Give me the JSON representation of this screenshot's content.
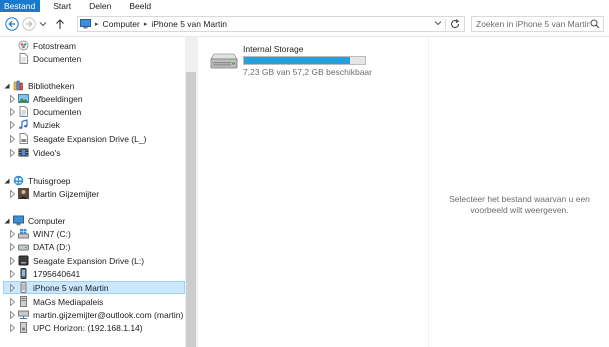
{
  "ribbon": {
    "tabs": [
      {
        "label": "Bestand",
        "active": true
      },
      {
        "label": "Start",
        "active": false
      },
      {
        "label": "Delen",
        "active": false
      },
      {
        "label": "Beeld",
        "active": false
      }
    ],
    "accent_color": "#1979ca"
  },
  "address_bar": {
    "crumbs": [
      "Computer",
      "iPhone 5 van Martin"
    ]
  },
  "search": {
    "placeholder": "Zoeken in iPhone 5 van Martin"
  },
  "nav_pane": {
    "items": [
      {
        "label": "Fotostream",
        "icon": "photostream-icon",
        "level": 1,
        "expander": "none"
      },
      {
        "label": "Documenten",
        "icon": "document-icon",
        "level": 1,
        "expander": "none"
      },
      {
        "label": "Bibliotheken",
        "icon": "libraries-icon",
        "level": 0,
        "expander": "expanded"
      },
      {
        "label": "Afbeeldingen",
        "icon": "pictures-icon",
        "level": 1,
        "expander": "collapsed"
      },
      {
        "label": "Documenten",
        "icon": "documents-library-icon",
        "level": 1,
        "expander": "collapsed"
      },
      {
        "label": "Muziek",
        "icon": "music-icon",
        "level": 1,
        "expander": "collapsed"
      },
      {
        "label": "Seagate Expansion Drive (L_)",
        "icon": "drive-library-icon",
        "level": 1,
        "expander": "collapsed"
      },
      {
        "label": "Video's",
        "icon": "videos-icon",
        "level": 1,
        "expander": "collapsed"
      },
      {
        "label": "Thuisgroep",
        "icon": "homegroup-icon",
        "level": 0,
        "expander": "expanded"
      },
      {
        "label": "Martin Gijzemijter",
        "icon": "user-photo-icon",
        "level": 1,
        "expander": "collapsed"
      },
      {
        "label": "Computer",
        "icon": "computer-icon",
        "level": 0,
        "expander": "expanded"
      },
      {
        "label": "WIN7 (C:)",
        "icon": "windows-drive-icon",
        "level": 1,
        "expander": "collapsed"
      },
      {
        "label": "DATA (D:)",
        "icon": "hard-drive-icon",
        "level": 1,
        "expander": "collapsed"
      },
      {
        "label": "Seagate Expansion Drive (L:)",
        "icon": "external-drive-icon",
        "level": 1,
        "expander": "collapsed"
      },
      {
        "label": "1795640641",
        "icon": "phone-icon",
        "level": 1,
        "expander": "collapsed"
      },
      {
        "label": "iPhone 5 van Martin",
        "icon": "iphone-icon",
        "level": 1,
        "expander": "collapsed",
        "selected": true
      },
      {
        "label": "MaGs Mediapaleis",
        "icon": "media-server-icon",
        "level": 1,
        "expander": "collapsed"
      },
      {
        "label": "martin.gijzemijter@outlook.com (martin)",
        "icon": "network-drive-icon",
        "level": 1,
        "expander": "collapsed"
      },
      {
        "label": "UPC Horizon: (192.168.1.14)",
        "icon": "media-device-icon",
        "level": 1,
        "expander": "collapsed"
      }
    ]
  },
  "content": {
    "drives": [
      {
        "name": "Internal Storage",
        "free_text": "7,23 GB van 57,2 GB beschikbaar",
        "used_fraction": 0.874,
        "bar_color": "#26a0da"
      }
    ]
  },
  "preview": {
    "message": "Selecteer het bestand waarvan u een voorbeeld wilt weergeven."
  }
}
